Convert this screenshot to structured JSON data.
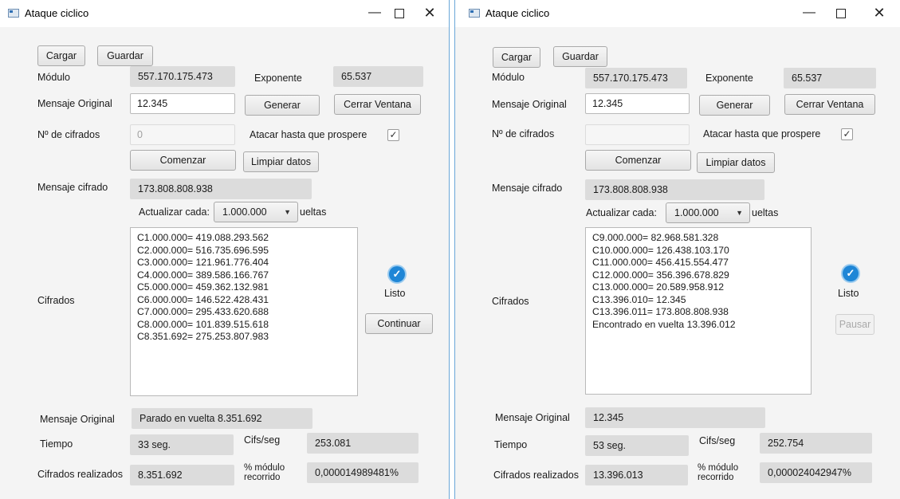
{
  "window1": {
    "title": "Ataque ciclico",
    "controls": {
      "minimize": "—",
      "maximize": "",
      "close": "✕"
    },
    "load_label": "Cargar",
    "save_label": "Guardar",
    "modulo_label": "Módulo",
    "modulo_value": "557.170.175.473",
    "exponente_label": "Exponente",
    "exponente_value": "65.537",
    "msg_orig_label": "Mensaje Original",
    "msg_orig_value": "12.345",
    "generar_label": "Generar",
    "cerrar_label": "Cerrar Ventana",
    "num_cifrados_label": "Nº de cifrados",
    "num_cifrados_placeholder": "0",
    "atacar_label": "Atacar hasta que prospere",
    "atacar_checked": "✓",
    "comenzar_label": "Comenzar",
    "limpiar_label": "Limpiar datos",
    "msg_cifrado_label": "Mensaje cifrado",
    "msg_cifrado_value": "173.808.808.938",
    "actualizar_label": "Actualizar cada:",
    "actualizar_value": "1.000.000",
    "vueltas_suffix": "ueltas",
    "cifrados_label": "Cifrados",
    "cifrados_lines": [
      "C1.000.000= 419.088.293.562",
      "C2.000.000= 516.735.696.595",
      "C3.000.000= 121.961.776.404",
      "C4.000.000= 389.586.166.767",
      "C5.000.000= 459.362.132.981",
      "C6.000.000= 146.522.428.431",
      "C7.000.000= 295.433.620.688",
      "C8.000.000= 101.839.515.618",
      "C8.351.692= 275.253.807.983"
    ],
    "status_label": "Listo",
    "action_label": "Continuar",
    "bottom_msg_label": "Mensaje Original",
    "bottom_msg_value": "Parado en vuelta 8.351.692",
    "tiempo_label": "Tiempo",
    "tiempo_value": "33 seg.",
    "cifs_label": "Cifs/seg",
    "cifs_value": "253.081",
    "realizados_label": "Cifrados realizados",
    "realizados_value": "8.351.692",
    "pct_label_1": "% módulo",
    "pct_label_2": "recorrido",
    "pct_value": "0,000014989481%"
  },
  "window2": {
    "title": "Ataque ciclico",
    "controls": {
      "minimize": "—",
      "maximize": "",
      "close": "✕"
    },
    "load_label": "Cargar",
    "save_label": "Guardar",
    "modulo_label": "Módulo",
    "modulo_value": "557.170.175.473",
    "exponente_label": "Exponente",
    "exponente_value": "65.537",
    "msg_orig_label": "Mensaje Original",
    "msg_orig_value": "12.345",
    "generar_label": "Generar",
    "cerrar_label": "Cerrar Ventana",
    "num_cifrados_label": "Nº de cifrados",
    "num_cifrados_placeholder": "",
    "atacar_label": "Atacar hasta que prospere",
    "atacar_checked": "✓",
    "comenzar_label": "Comenzar",
    "limpiar_label": "Limpiar datos",
    "msg_cifrado_label": "Mensaje cifrado",
    "msg_cifrado_value": "173.808.808.938",
    "actualizar_label": "Actualizar cada:",
    "actualizar_value": "1.000.000",
    "vueltas_suffix": "ueltas",
    "cifrados_label": "Cifrados",
    "cifrados_lines": [
      "C9.000.000= 82.968.581.328",
      "C10.000.000= 126.438.103.170",
      "C11.000.000= 456.415.554.477",
      "C12.000.000= 356.396.678.829",
      "C13.000.000= 20.589.958.912",
      "C13.396.010= 12.345",
      "C13.396.011= 173.808.808.938",
      "Encontrado en vuelta 13.396.012"
    ],
    "status_label": "Listo",
    "action_label": "Pausar",
    "bottom_msg_label": "Mensaje Original",
    "bottom_msg_value": "12.345",
    "tiempo_label": "Tiempo",
    "tiempo_value": "53 seg.",
    "cifs_label": "Cifs/seg",
    "cifs_value": "252.754",
    "realizados_label": "Cifrados realizados",
    "realizados_value": "13.396.013",
    "pct_label_1": "% módulo",
    "pct_label_2": "recorrido",
    "pct_value": "0,000024042947%"
  },
  "icons": {
    "status": "check-circle-icon",
    "app": "app-window-icon",
    "combo": "chevron-down-icon"
  },
  "colors": {
    "status_blue": "#1f86d6",
    "field_gray": "#dcdcdc",
    "window_border": "#6aa7d8"
  }
}
